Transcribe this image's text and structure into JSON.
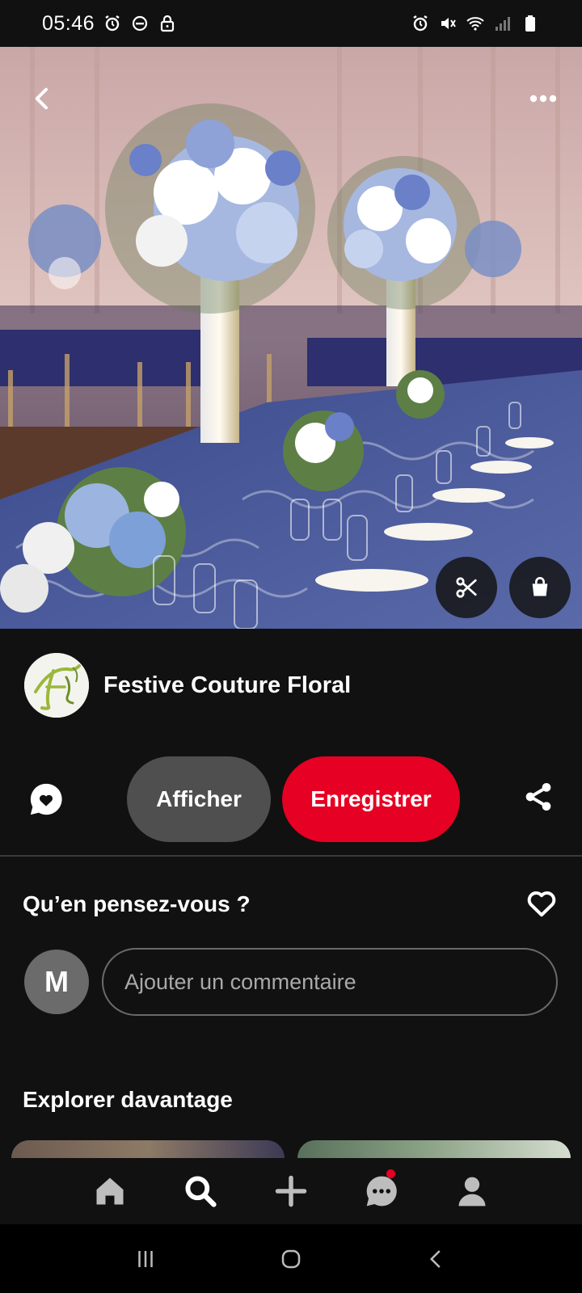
{
  "status_bar": {
    "time": "05:46",
    "left_icons": [
      "alarm-icon",
      "do-not-disturb-icon",
      "lock-icon"
    ],
    "right_icons": [
      "alarm-icon",
      "mute-icon",
      "wifi-icon",
      "signal-icon",
      "battery-icon"
    ]
  },
  "pin": {
    "image_icons": {
      "back": "back-arrow-icon",
      "more": "more-dots-icon",
      "lens": "scissors-icon",
      "shop": "shopping-bag-icon"
    }
  },
  "creator": {
    "name": "Festive Couture Floral"
  },
  "actions": {
    "view_label": "Afficher",
    "save_label": "Enregistrer"
  },
  "feedback": {
    "title": "Qu’en pensez-vous ?"
  },
  "comment": {
    "avatar_initial": "M",
    "placeholder": "Ajouter un commentaire"
  },
  "explore": {
    "title": "Explorer davantage"
  },
  "bottom_nav": {
    "items": [
      "home-icon",
      "search-icon",
      "add-icon",
      "messages-icon",
      "profile-icon"
    ]
  },
  "colors": {
    "background": "#111111",
    "save_button": "#e60023",
    "view_button": "#4f4f4f",
    "notification_dot": "#e60023"
  }
}
